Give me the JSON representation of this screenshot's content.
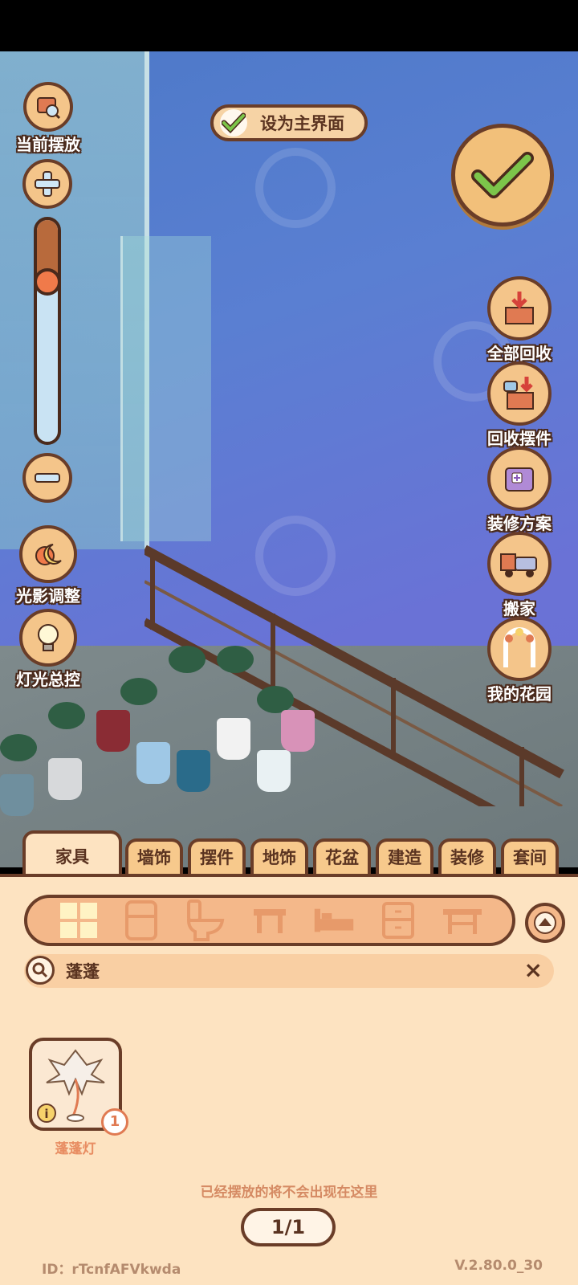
{
  "left_controls": {
    "current_placement": "当前摆放",
    "zoom_level_fraction": 0.28,
    "light_shadow": "光影调整",
    "light_master": "灯光总控"
  },
  "set_main": {
    "label": "设为主界面",
    "checked": true
  },
  "right_buttons": [
    {
      "label": "全部回收",
      "icon": "box-arrow-down-icon"
    },
    {
      "label": "回收摆件",
      "icon": "mug-box-icon"
    },
    {
      "label": "装修方案",
      "icon": "folder-plus-icon"
    },
    {
      "label": "搬家",
      "icon": "moving-truck-icon"
    },
    {
      "label": "我的花园",
      "icon": "garden-arch-icon"
    }
  ],
  "tabs": [
    "家具",
    "墙饰",
    "摆件",
    "地饰",
    "花盆",
    "建造",
    "装修",
    "套间"
  ],
  "active_tab": 0,
  "categories": [
    "grid-icon",
    "fridge-icon",
    "toilet-icon",
    "table-icon",
    "bed-icon",
    "cabinet-icon",
    "desk-icon"
  ],
  "search": {
    "value": "蓬蓬",
    "clear": "×"
  },
  "items": [
    {
      "name": "蓬蓬灯",
      "count": "1",
      "info": "i"
    }
  ],
  "hint": "已经摆放的将不会出现在这里",
  "pager": "1/1",
  "footer": {
    "id": "ID：rTcnfAFVkwda",
    "version": "V.2.80.0_30"
  },
  "colors": {
    "panel": "#fde3c1",
    "outline": "#6a3d28",
    "accent": "#f4b88a",
    "sky": "#5a7fd2"
  }
}
